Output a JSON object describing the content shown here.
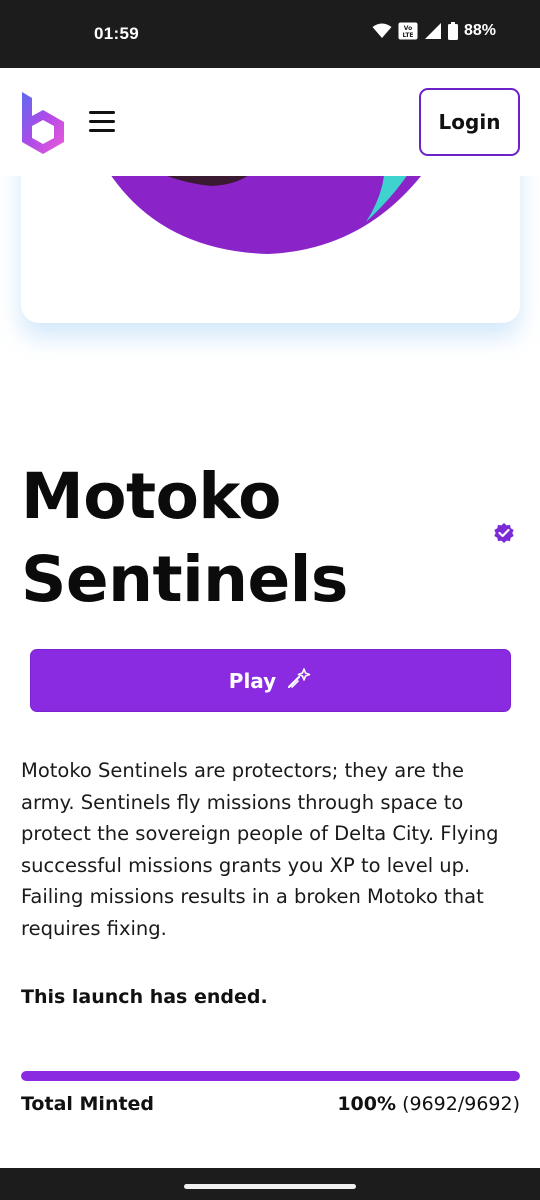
{
  "status_bar": {
    "time": "01:59",
    "battery": "88%",
    "network_badge": "Vo LTE"
  },
  "header": {
    "login_label": "Login"
  },
  "collection": {
    "title_line1": "Motoko",
    "title_line2": "Sentinels",
    "play_label": "Play",
    "description": "Motoko Sentinels are protectors; they are the army. Sentinels fly missions through space to protect the sovereign people of Delta City. Flying successful missions grants you XP to level up. Failing missions results in a broken Motoko that requires fixing.",
    "launch_status": "This launch has ended.",
    "minted_label": "Total Minted",
    "minted_percent": "100%",
    "minted_count": "(9692/9692)",
    "minted_fraction": 1.0
  },
  "colors": {
    "accent": "#8a2be2",
    "status_bar": "#1c1c1c",
    "login_border": "#6b22c9"
  },
  "icons": {
    "logo": "b-logo-icon",
    "menu": "hamburger-menu-icon",
    "verified": "verified-badge-icon",
    "play": "magic-wand-icon"
  }
}
